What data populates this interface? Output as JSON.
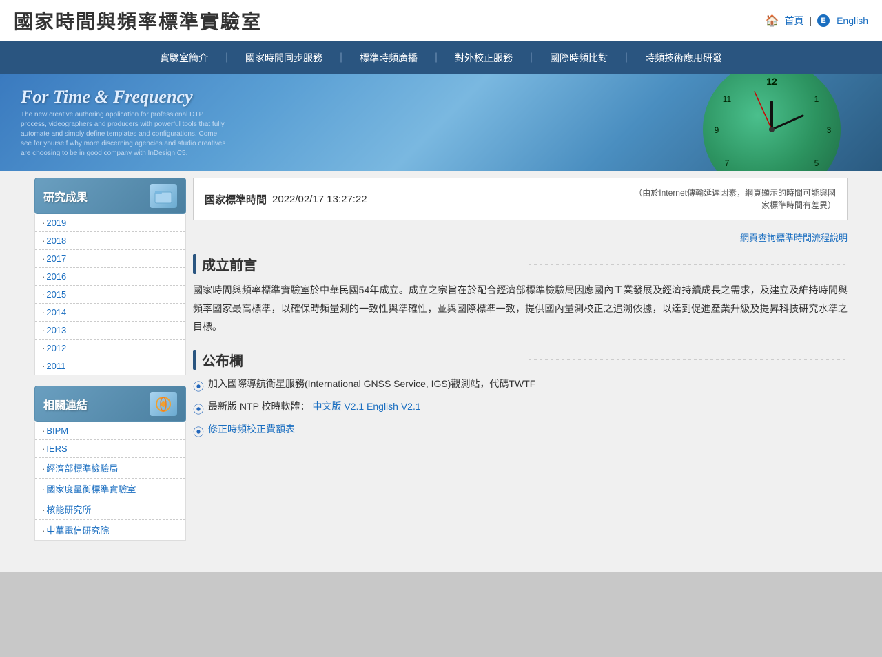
{
  "header": {
    "site_title": "國家時間與頻率標準實驗室",
    "home_label": "首頁",
    "english_label": "English",
    "separator": "|"
  },
  "navbar": {
    "items": [
      {
        "label": "實驗室簡介",
        "href": "#"
      },
      {
        "label": "國家時間同步服務",
        "href": "#"
      },
      {
        "label": "標準時頻廣播",
        "href": "#"
      },
      {
        "label": "對外校正服務",
        "href": "#"
      },
      {
        "label": "國際時頻比對",
        "href": "#"
      },
      {
        "label": "時頻技術應用研發",
        "href": "#"
      }
    ]
  },
  "banner": {
    "title": "For Time & Frequency",
    "subtitle": "The new creative authoring application for professional DTP process, videographers and producers with powerful tools that fully automate and simply define templates and configurations. Come see for yourself why more discerning agencies and studio creatives are choosing to be in good company with InDesign C5."
  },
  "time_display": {
    "label": "國家標準時間",
    "value": "2022/02/17 13:27:22",
    "note": "（由於Internet傳輸延遲因素，網頁顯示的時間可能與國家標準時間有差異）",
    "link_text": "網頁查詢標準時間流程說明",
    "link_href": "#"
  },
  "sidebar": {
    "research_header": "研究成果",
    "research_links": [
      {
        "label": "2019",
        "href": "#"
      },
      {
        "label": "2018",
        "href": "#"
      },
      {
        "label": "2017",
        "href": "#"
      },
      {
        "label": "2016",
        "href": "#"
      },
      {
        "label": "2015",
        "href": "#"
      },
      {
        "label": "2014",
        "href": "#"
      },
      {
        "label": "2013",
        "href": "#"
      },
      {
        "label": "2012",
        "href": "#"
      },
      {
        "label": "2011",
        "href": "#"
      }
    ],
    "related_header": "相關連結",
    "related_links": [
      {
        "label": "BIPM",
        "href": "#"
      },
      {
        "label": "IERS",
        "href": "#"
      },
      {
        "label": "經濟部標準檢驗局",
        "href": "#"
      },
      {
        "label": "國家度量衡標準實驗室",
        "href": "#"
      },
      {
        "label": "核能研究所",
        "href": "#"
      },
      {
        "label": "中華電信研究院",
        "href": "#"
      }
    ]
  },
  "about_section": {
    "title": "成立前言",
    "body": "國家時間與頻率標準實驗室於中華民國54年成立。成立之宗旨在於配合經濟部標準檢驗局因應國內工業發展及經濟持續成長之需求，及建立及維持時間與頻率國家最高標準，以確保時頻量測的一致性與準確性，並與國際標準一致，提供國內量測校正之追溯依據，以達到促進產業升級及提昇科技研究水準之目標。"
  },
  "bulletin_section": {
    "title": "公布欄",
    "items": [
      {
        "text": "加入國際導航衛星服務(International GNSS Service, IGS)觀測站，代碼TWTF",
        "has_links": false
      },
      {
        "text_before": "最新版 NTP 校時軟體：",
        "link1_text": "中文版 V2.1",
        "link1_href": "#",
        "link2_text": "English V2.1",
        "link2_href": "#",
        "has_links": true
      },
      {
        "text": "修正時頻校正費額表",
        "link_href": "#",
        "is_link": true,
        "has_links": false
      }
    ]
  }
}
